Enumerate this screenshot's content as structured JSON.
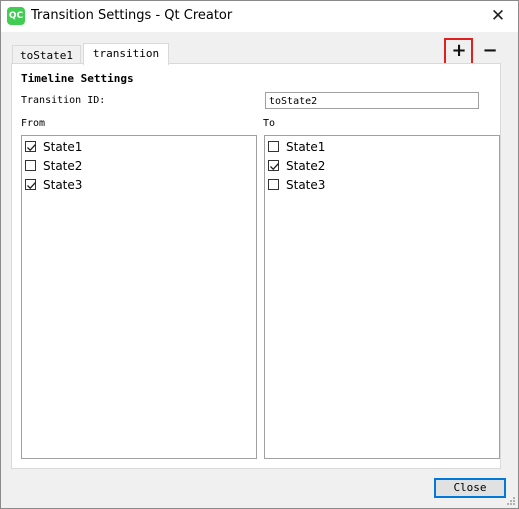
{
  "window": {
    "title": "Transition Settings - Qt Creator",
    "app_icon": "QC",
    "close_glyph": "✕"
  },
  "tabs": [
    {
      "label": "toState1",
      "active": false
    },
    {
      "label": "transition",
      "active": true
    }
  ],
  "toolbar": {
    "add_label": "+",
    "remove_label": "−"
  },
  "form": {
    "section_title": "Timeline Settings",
    "transition_id_label": "Transition ID:",
    "transition_id_value": "toState2",
    "from_label": "From",
    "to_label": "To"
  },
  "from_states": [
    {
      "label": "State1",
      "checked": true
    },
    {
      "label": "State2",
      "checked": false
    },
    {
      "label": "State3",
      "checked": true
    }
  ],
  "to_states": [
    {
      "label": "State1",
      "checked": false
    },
    {
      "label": "State2",
      "checked": true
    },
    {
      "label": "State3",
      "checked": false
    }
  ],
  "footer": {
    "close_label": "Close"
  }
}
